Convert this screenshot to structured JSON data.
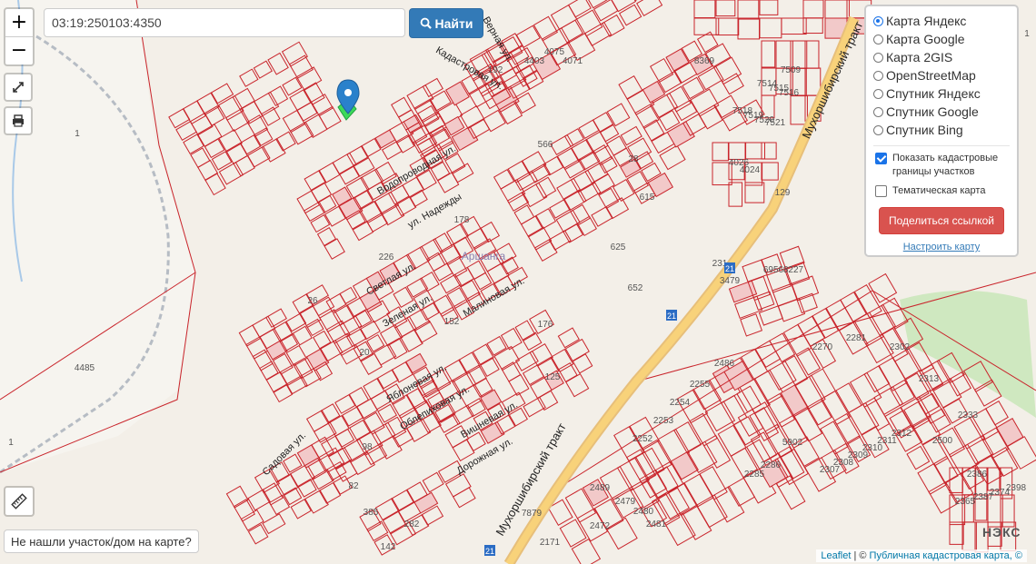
{
  "search": {
    "value": "03:19:250103:4350",
    "button_label": "Найти"
  },
  "zoom": {
    "in_label": "+",
    "out_label": "−"
  },
  "layers": {
    "options": [
      {
        "label": "Карта Яндекс",
        "selected": true
      },
      {
        "label": "Карта Google",
        "selected": false
      },
      {
        "label": "Карта 2GIS",
        "selected": false
      },
      {
        "label": "OpenStreetMap",
        "selected": false
      },
      {
        "label": "Спутник Яндекс",
        "selected": false
      },
      {
        "label": "Спутник Google",
        "selected": false
      },
      {
        "label": "Спутник Bing",
        "selected": false
      }
    ],
    "cadastral_label": "Показать кадастровые границы участков",
    "cadastral_checked": true,
    "thematic_label": "Тематическая карта",
    "thematic_checked": false,
    "share_label": "Поделиться ссылкой",
    "setup_label": "Настроить карту"
  },
  "not_found_label": "Не нашли участок/дом на карте?",
  "attribution": {
    "leaflet": "Leaflet",
    "sep": " | © ",
    "source": "Публичная кадастровая карта, ©"
  },
  "watermark": "НЭКС",
  "map": {
    "street_labels": [
      "Верная ул.",
      "Кадастровая ул.",
      "Водопроводная ул.",
      "ул. Надежды",
      "Светлая ул.",
      "Зеленая ул.",
      "Малиновая ул.",
      "Яблоневая ул.",
      "Облепиховая ул.",
      "Вишневая ул.",
      "Дорожная ул.",
      "Садовая ул.",
      "Мухоршибирский тракт",
      "Мухоршибирский тракт"
    ],
    "district_label": "Аршанга",
    "parcel_numbers": [
      "4075",
      "4071",
      "4403",
      "192",
      "8369",
      "7518",
      "7519",
      "7520",
      "7521",
      "7514",
      "7515",
      "7516",
      "7509",
      "566",
      "28",
      "615",
      "652",
      "625",
      "129",
      "231",
      "3479",
      "6956",
      "8227",
      "2270",
      "2281",
      "2302",
      "2313",
      "2333",
      "2252",
      "2253",
      "2254",
      "2255",
      "2486",
      "2489",
      "2479",
      "2480",
      "2481",
      "2472",
      "2171",
      "4485",
      "226",
      "178",
      "152",
      "176",
      "125",
      "26",
      "20",
      "98",
      "82",
      "385",
      "282",
      "142",
      "1",
      "1",
      "1",
      "5902",
      "2500",
      "7879",
      "4026",
      "4024",
      "2307",
      "2308",
      "2309",
      "2310",
      "2311",
      "2312",
      "2365",
      "2387",
      "2386",
      "2374",
      "2398",
      "2285",
      "2286"
    ],
    "route_badge": "21"
  },
  "colors": {
    "parcel_border": "#c9242b",
    "road_major": "#f8d27a",
    "accent_primary": "#337ab7",
    "accent_danger": "#d9534f",
    "marker_blue": "#2a81cb",
    "marker_green": "#3cd95a"
  },
  "icons": {
    "fullscreen": "expand-icon",
    "print": "printer-icon",
    "ruler": "ruler-icon",
    "search": "magnifier-icon",
    "marker": "map-pin-icon"
  }
}
